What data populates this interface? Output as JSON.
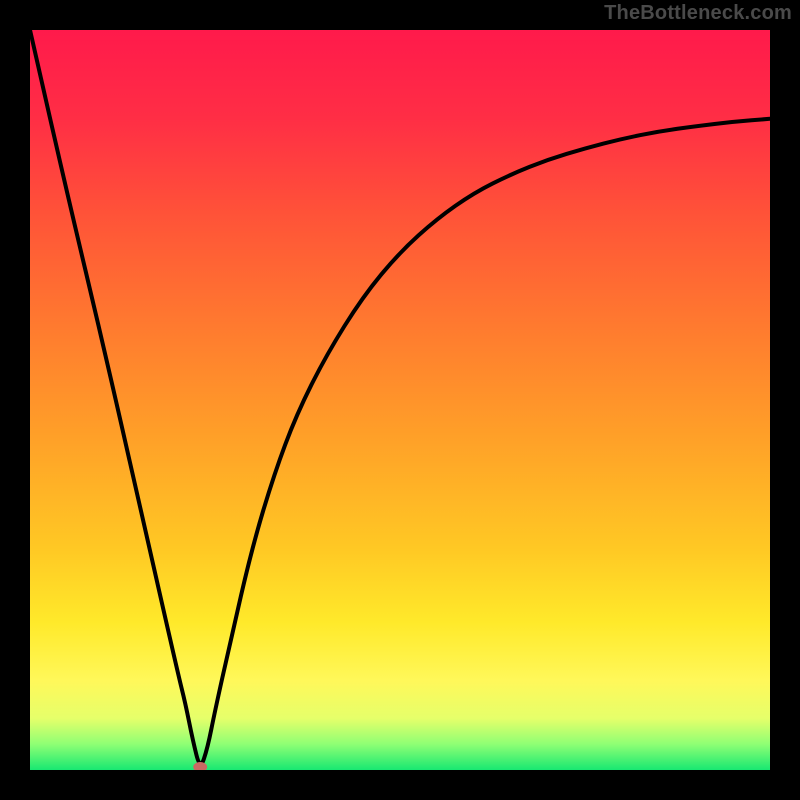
{
  "watermark": "TheBottleneck.com",
  "colors": {
    "frame": "#000000",
    "stroke": "#000000",
    "gradient_stops": [
      {
        "offset": 0.0,
        "color": "#ff1a4b"
      },
      {
        "offset": 0.12,
        "color": "#ff2e45"
      },
      {
        "offset": 0.25,
        "color": "#ff5338"
      },
      {
        "offset": 0.4,
        "color": "#ff7a2f"
      },
      {
        "offset": 0.55,
        "color": "#ffa028"
      },
      {
        "offset": 0.7,
        "color": "#ffc824"
      },
      {
        "offset": 0.8,
        "color": "#ffe92a"
      },
      {
        "offset": 0.88,
        "color": "#fff85a"
      },
      {
        "offset": 0.93,
        "color": "#e6ff6a"
      },
      {
        "offset": 0.965,
        "color": "#8fff74"
      },
      {
        "offset": 1.0,
        "color": "#18e872"
      }
    ],
    "dot": "#c96a63"
  },
  "chart_data": {
    "type": "line",
    "title": "",
    "xlabel": "",
    "ylabel": "",
    "xlim": [
      0,
      100
    ],
    "ylim": [
      0,
      100
    ],
    "minimum_marker": {
      "x": 23,
      "y": 0
    },
    "series": [
      {
        "name": "bottleneck-curve",
        "x": [
          0,
          5,
          10,
          15,
          20,
          21,
          22,
          23,
          24,
          25,
          27,
          30,
          33,
          36,
          40,
          45,
          50,
          55,
          60,
          65,
          70,
          75,
          80,
          85,
          90,
          95,
          100
        ],
        "y": [
          100,
          78,
          57,
          35,
          13,
          9,
          4,
          0,
          3,
          8,
          17,
          30,
          40,
          48,
          56,
          64,
          70,
          74.5,
          78,
          80.5,
          82.5,
          84,
          85.3,
          86.3,
          87,
          87.6,
          88
        ]
      }
    ]
  }
}
